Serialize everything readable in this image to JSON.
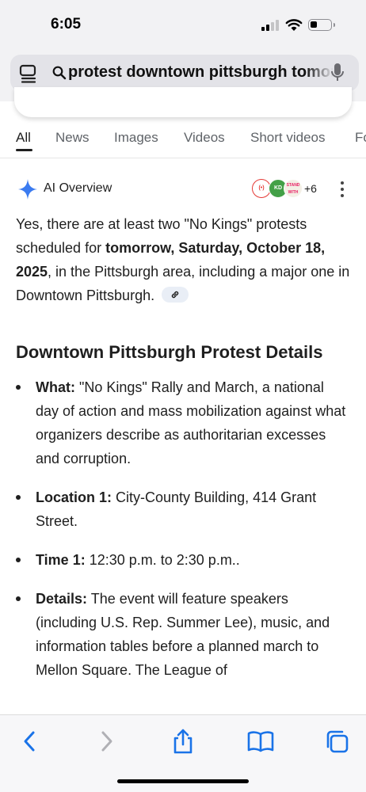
{
  "status_bar": {
    "time": "6:05"
  },
  "address_bar": {
    "query": "protest downtown pittsburgh tomorrow"
  },
  "tabs": [
    {
      "label": "All",
      "active": true
    },
    {
      "label": "News"
    },
    {
      "label": "Images"
    },
    {
      "label": "Videos"
    },
    {
      "label": "Short videos"
    },
    {
      "label": "Forums"
    }
  ],
  "ai_overview": {
    "title": "AI Overview",
    "sources": [
      {
        "text": "(•)",
        "color": "#e53935"
      },
      {
        "text": "KD",
        "color": "#43a047"
      },
      {
        "text": "STAND WITH",
        "color": "#e91e63"
      }
    ],
    "more_sources": "+6",
    "intro": {
      "p1": "Yes, there are at least two \"No Kings\" protests scheduled for ",
      "bold": "tomorrow, Saturday, October 18, 2025",
      "p2": ", in the Pittsburgh area, including a major one in Downtown Pittsburgh."
    },
    "section_title": "Downtown Pittsburgh Protest Details",
    "bullets": [
      {
        "label": "What:",
        "text": " \"No Kings\" Rally and March, a national day of action and mass mobilization against what organizers describe as authoritarian excesses and corruption."
      },
      {
        "label": "Location 1:",
        "text": " City-County Building, 414 Grant Street."
      },
      {
        "label": "Time 1:",
        "text": " 12:30 p.m. to 2:30 p.m.."
      },
      {
        "label": "Details:",
        "text": " The event will feature speakers (including U.S. Rep. Summer Lee), music, and information tables before a planned march to Mellon Square. The League of"
      }
    ]
  }
}
